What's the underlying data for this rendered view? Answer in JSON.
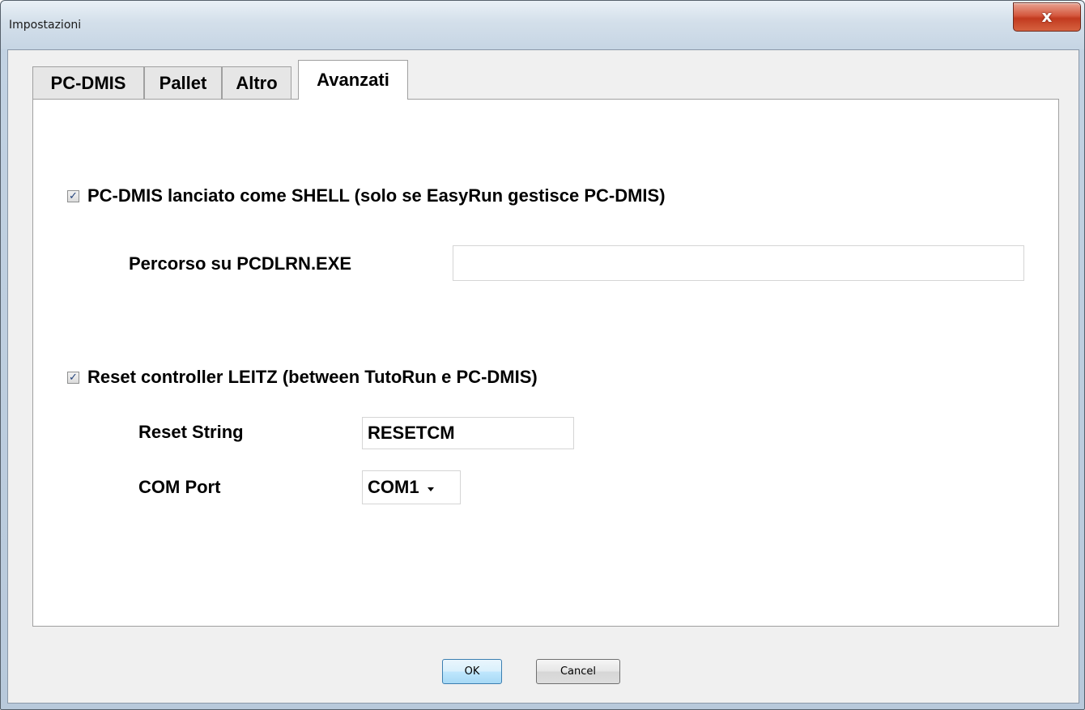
{
  "window": {
    "title": "Impostazioni",
    "close_glyph": "x"
  },
  "tabs": [
    {
      "label": "PC-DMIS",
      "active": false
    },
    {
      "label": "Pallet",
      "active": false
    },
    {
      "label": "Altro",
      "active": false
    },
    {
      "label": "Avanzati",
      "active": true
    }
  ],
  "avanzati": {
    "shell": {
      "label": "PC-DMIS lanciato come SHELL (solo se EasyRun gestisce PC-DMIS)",
      "checked": true
    },
    "path": {
      "label": "Percorso su PCDLRN.EXE",
      "value": ""
    },
    "reset": {
      "label": "Reset controller LEITZ (between TutoRun e PC-DMIS)",
      "checked": true
    },
    "reset_string": {
      "label": "Reset String",
      "value": "RESETCM"
    },
    "com_port": {
      "label": "COM Port",
      "value": "COM1"
    }
  },
  "buttons": {
    "ok": "OK",
    "cancel": "Cancel"
  },
  "check_glyph": "✓"
}
